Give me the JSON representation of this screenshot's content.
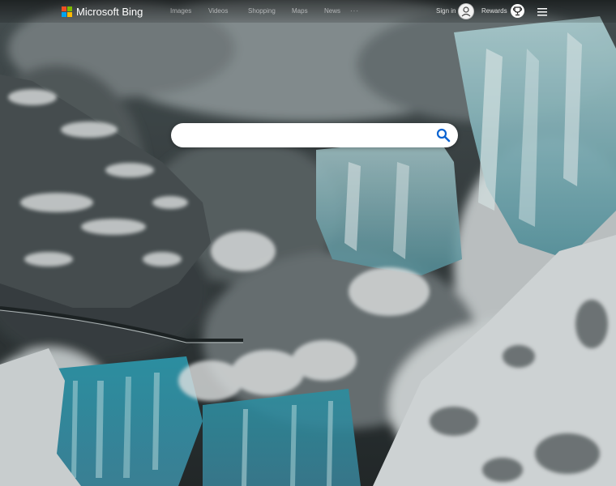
{
  "brand": {
    "name": "Microsoft Bing",
    "logo_colors": [
      "#f25022",
      "#7fba00",
      "#00a4ef",
      "#ffb900"
    ]
  },
  "nav": {
    "items": [
      "Images",
      "Videos",
      "Shopping",
      "Maps",
      "News"
    ],
    "more": "···"
  },
  "account": {
    "signin": "Sign in",
    "rewards": "Rewards"
  },
  "search": {
    "value": "",
    "placeholder": ""
  },
  "icons": {
    "search": "search-icon",
    "avatar": "user-avatar-icon",
    "rewards": "trophy-icon",
    "menu": "hamburger-menu-icon"
  },
  "colors": {
    "accent": "#0a63d1",
    "text_light": "#ffffff"
  }
}
